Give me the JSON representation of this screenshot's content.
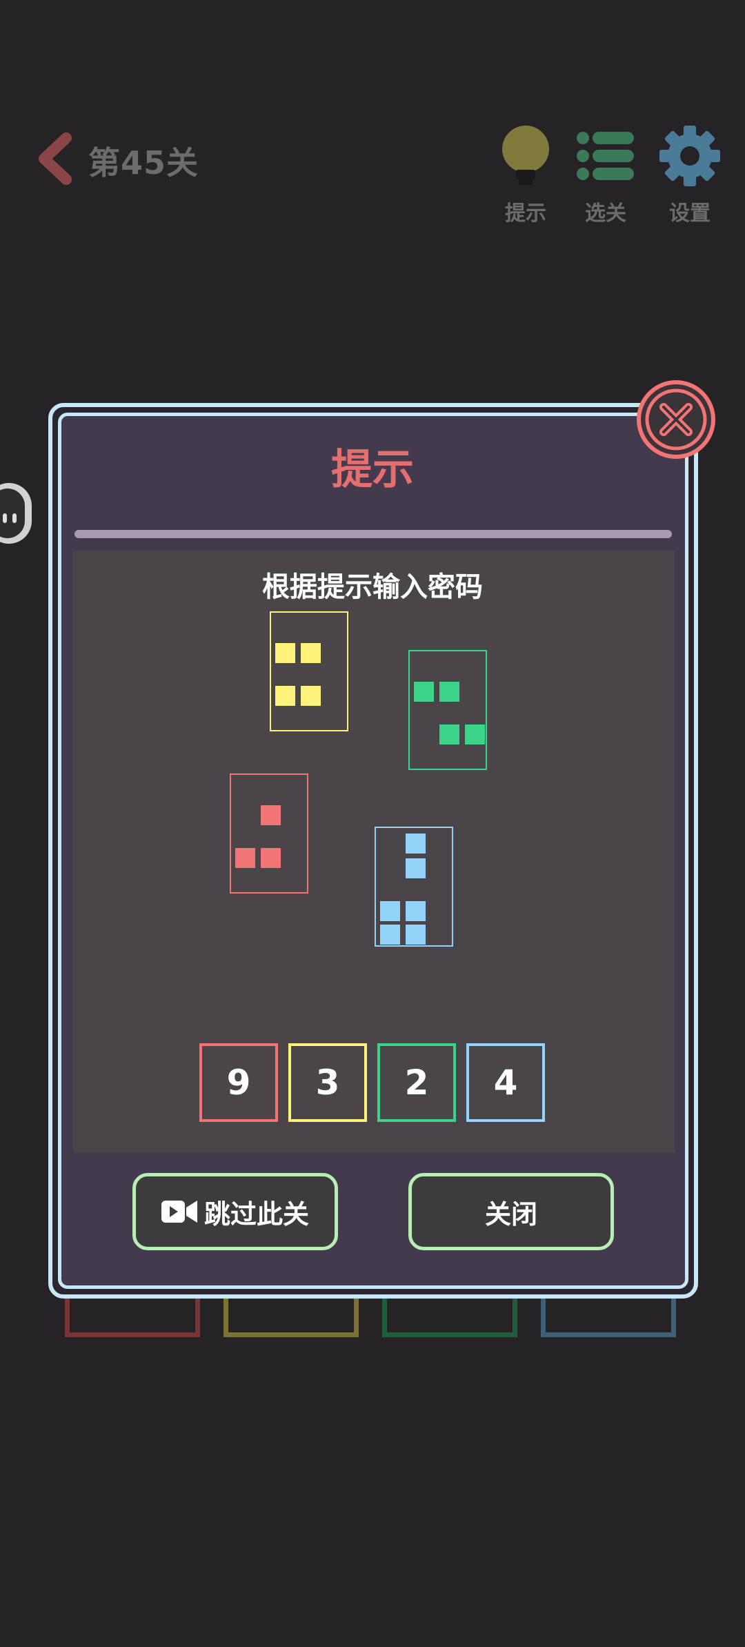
{
  "header": {
    "level_title": "第45关",
    "hint_label": "提示",
    "levels_label": "选关",
    "settings_label": "设置"
  },
  "dialog": {
    "title": "提示",
    "instruction": "根据提示输入密码",
    "code_digits": [
      "9",
      "3",
      "2",
      "4"
    ],
    "skip_label": "跳过此关",
    "close_label": "关闭"
  },
  "colors": {
    "red": "#f27474",
    "yellow": "#fff27a",
    "green": "#3ed487",
    "blue": "#94d4fb",
    "accent_title": "#e56f6f",
    "button_border": "#b6eeb3",
    "dialog_border": "#c8e7f8"
  },
  "icons": {
    "back": "chevron-left-icon",
    "hint": "lightbulb-icon",
    "levels": "list-icon",
    "settings": "gear-icon",
    "close": "close-icon",
    "video": "video-camera-icon"
  }
}
